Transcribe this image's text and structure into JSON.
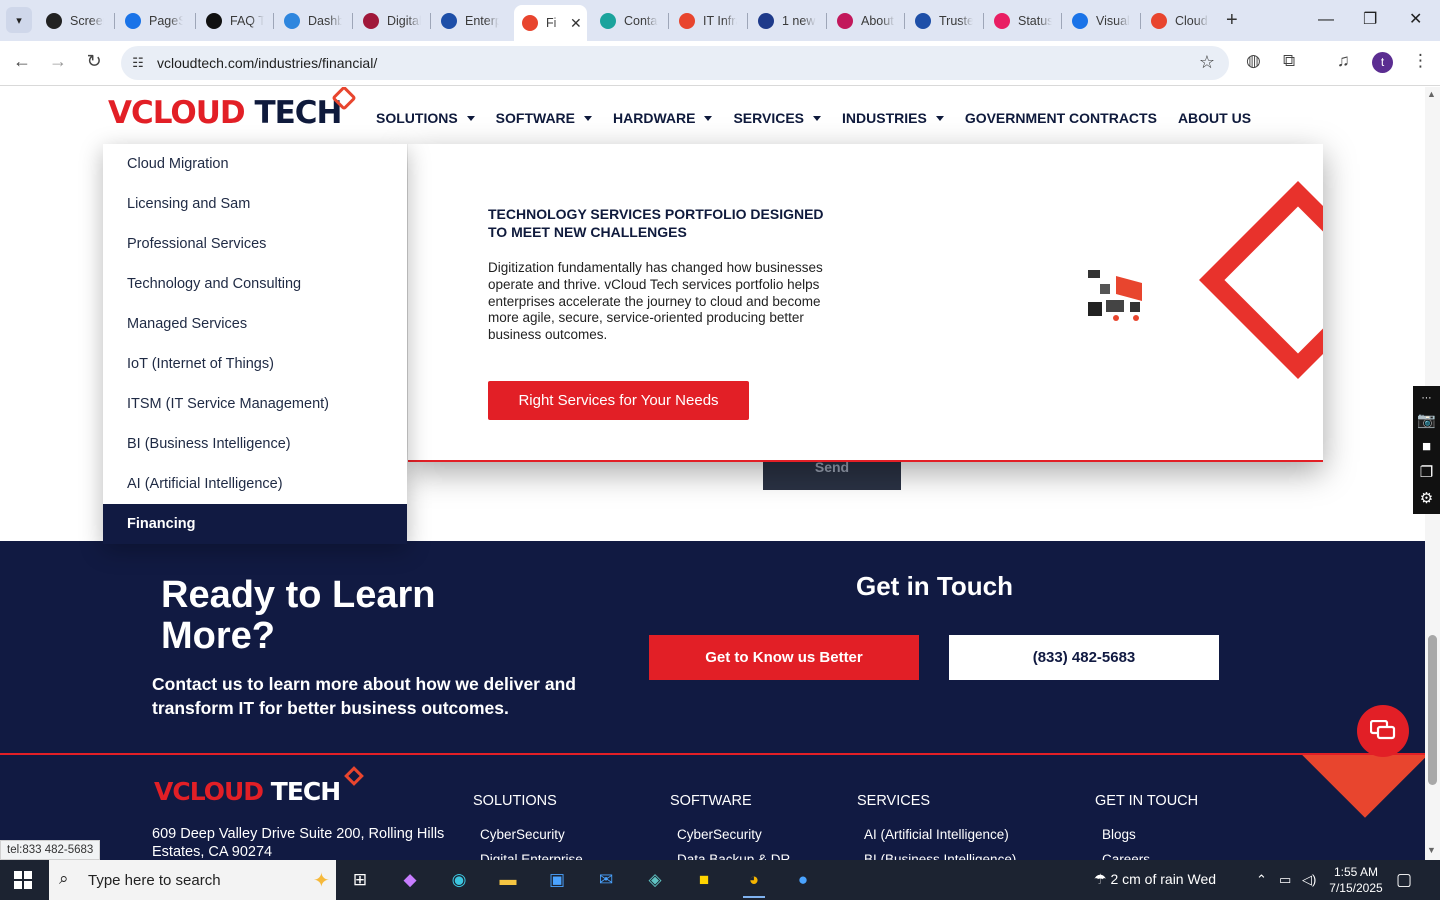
{
  "browser": {
    "tabs": [
      {
        "title": "Screen",
        "fav_color": "#222222",
        "fav_icon": "gear-icon"
      },
      {
        "title": "PageSpeed",
        "fav_color": "#1a73e8",
        "fav_icon": "speed-icon"
      },
      {
        "title": "FAQ T",
        "fav_color": "#111111",
        "fav_icon": "faq-icon"
      },
      {
        "title": "Dashboard",
        "fav_color": "#2e86de",
        "fav_icon": "dashboard-icon"
      },
      {
        "title": "Digital",
        "fav_color": "#a0183a",
        "fav_icon": "v-icon"
      },
      {
        "title": "Enterprise",
        "fav_color": "#1e4fa8",
        "fav_icon": "check-icon"
      },
      {
        "title": "Fi",
        "fav_color": "#e8452e",
        "fav_icon": "vcloud-icon"
      },
      {
        "title": "Contact",
        "fav_color": "#1ba39c",
        "fav_icon": "contact-icon"
      },
      {
        "title": "IT Infra",
        "fav_color": "#e8452e",
        "fav_icon": "vcloud-icon"
      },
      {
        "title": "1 new",
        "fav_color": "#1e3a8a",
        "fav_icon": "x-icon"
      },
      {
        "title": "About",
        "fav_color": "#c2185b",
        "fav_icon": "about-icon"
      },
      {
        "title": "Trusted",
        "fav_color": "#1e4fa8",
        "fav_icon": "scale-icon"
      },
      {
        "title": "Status",
        "fav_color": "#e91e63",
        "fav_icon": "status-icon"
      },
      {
        "title": "Visual",
        "fav_color": "#1a73e8",
        "fav_icon": "pulse-icon"
      },
      {
        "title": "Cloud",
        "fav_color": "#e8452e",
        "fav_icon": "cloud-icon"
      }
    ],
    "active_tab_index": 6,
    "url": "vcloudtech.com/industries/financial/",
    "profile_initial": "t"
  },
  "site": {
    "logo": {
      "v": "V",
      "cloud": "CLOUD",
      "tech": " TECH"
    },
    "nav": [
      {
        "label": "SOLUTIONS",
        "dropdown": true
      },
      {
        "label": "SOFTWARE",
        "dropdown": true
      },
      {
        "label": "HARDWARE",
        "dropdown": true
      },
      {
        "label": "SERVICES",
        "dropdown": true
      },
      {
        "label": "INDUSTRIES",
        "dropdown": true
      },
      {
        "label": "GOVERNMENT CONTRACTS",
        "dropdown": false
      },
      {
        "label": "ABOUT US",
        "dropdown": false
      }
    ],
    "services_menu": [
      "Cloud Migration",
      "Licensing and Sam",
      "Professional Services",
      "Technology and Consulting",
      "Managed Services",
      "IoT (Internet of Things)",
      "ITSM (IT Service Management)",
      "BI  (Business Intelligence)",
      "AI  (Artificial Intelligence)",
      "Financing"
    ],
    "services_menu_selected": 9,
    "mega": {
      "title": "TECHNOLOGY SERVICES PORTFOLIO DESIGNED TO MEET NEW CHALLENGES",
      "body": "Digitization fundamentally has changed how businesses operate and thrive. vCloud Tech services portfolio helps enterprises accelerate the journey to cloud and become more agile, secure, service-oriented producing better business outcomes.",
      "button": "Right Services for Your Needs"
    },
    "send_label": "Send",
    "cta": {
      "heading": "Ready to Learn More?",
      "text": "Contact us to learn more about how we deliver and transform IT for better business outcomes.",
      "get_in_touch": "Get in Touch",
      "btn_primary": "Get to Know us Better",
      "btn_phone": "(833) 482-5683"
    },
    "footer": {
      "address": "609 Deep Valley Drive Suite 200, Rolling Hills Estates, CA 90274",
      "columns": [
        {
          "heading": "SOLUTIONS",
          "links": [
            "CyberSecurity",
            "Digital Enterprise"
          ]
        },
        {
          "heading": "SOFTWARE",
          "links": [
            "CyberSecurity",
            "Data Backup & DR"
          ]
        },
        {
          "heading": "SERVICES",
          "links": [
            "AI (Artificial Intelligence)",
            "BI (Business Intelligence)"
          ]
        },
        {
          "heading": "GET IN TOUCH",
          "links": [
            "Blogs",
            "Careers"
          ]
        }
      ]
    },
    "status_link": "tel:833 482-5683",
    "colors": {
      "brand_red": "#e21f26",
      "brand_navy": "#111a42"
    }
  },
  "taskbar": {
    "search_placeholder": "Type here to search",
    "weather": "2 cm of rain Wed",
    "time": "1:55 AM",
    "date": "7/15/2025"
  }
}
